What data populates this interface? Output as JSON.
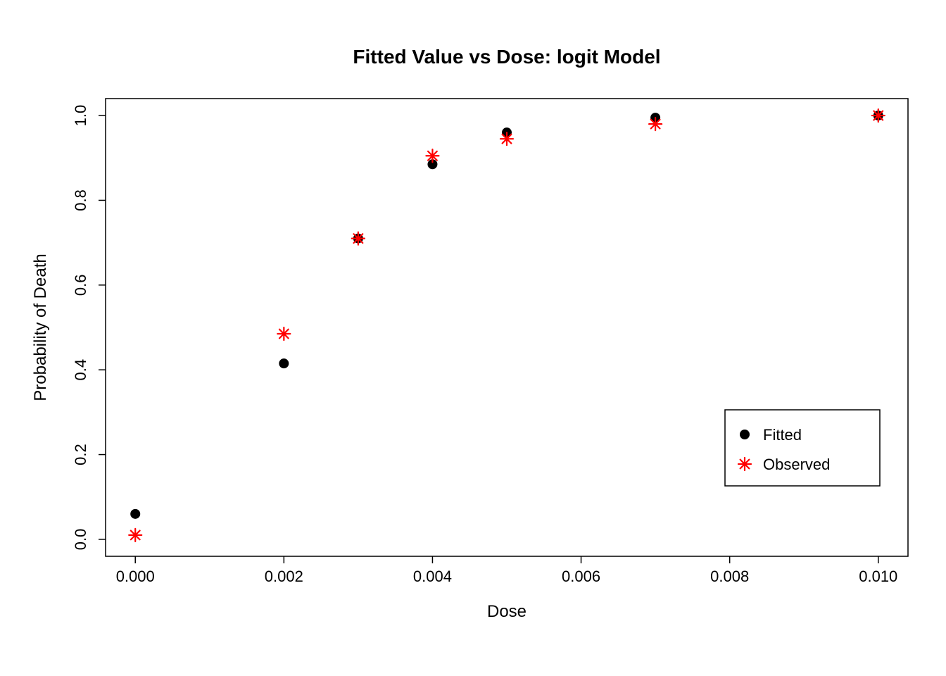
{
  "chart_data": {
    "type": "scatter",
    "title": "Fitted Value vs Dose: logit Model",
    "xlabel": "Dose",
    "ylabel": "Probability of Death",
    "xlim": [
      0.0,
      0.01
    ],
    "ylim": [
      0.0,
      1.0
    ],
    "x_ticks": [
      0.0,
      0.002,
      0.004,
      0.006,
      0.008,
      0.01
    ],
    "x_tick_labels": [
      "0.000",
      "0.002",
      "0.004",
      "0.006",
      "0.008",
      "0.010"
    ],
    "y_ticks": [
      0.0,
      0.2,
      0.4,
      0.6,
      0.8,
      1.0
    ],
    "y_tick_labels": [
      "0.0",
      "0.2",
      "0.4",
      "0.6",
      "0.8",
      "1.0"
    ],
    "series": [
      {
        "name": "Fitted",
        "marker": "filled-circle",
        "color": "#000000",
        "x": [
          0.0,
          0.002,
          0.003,
          0.004,
          0.005,
          0.007,
          0.01
        ],
        "y": [
          0.06,
          0.415,
          0.71,
          0.885,
          0.96,
          0.995,
          1.0
        ]
      },
      {
        "name": "Observed",
        "marker": "asterisk",
        "color": "#ff0000",
        "x": [
          0.0,
          0.002,
          0.003,
          0.004,
          0.005,
          0.007,
          0.01
        ],
        "y": [
          0.01,
          0.485,
          0.71,
          0.905,
          0.945,
          0.98,
          1.0
        ]
      }
    ],
    "legend": {
      "position": "bottom-right",
      "entries": [
        "Fitted",
        "Observed"
      ]
    }
  }
}
